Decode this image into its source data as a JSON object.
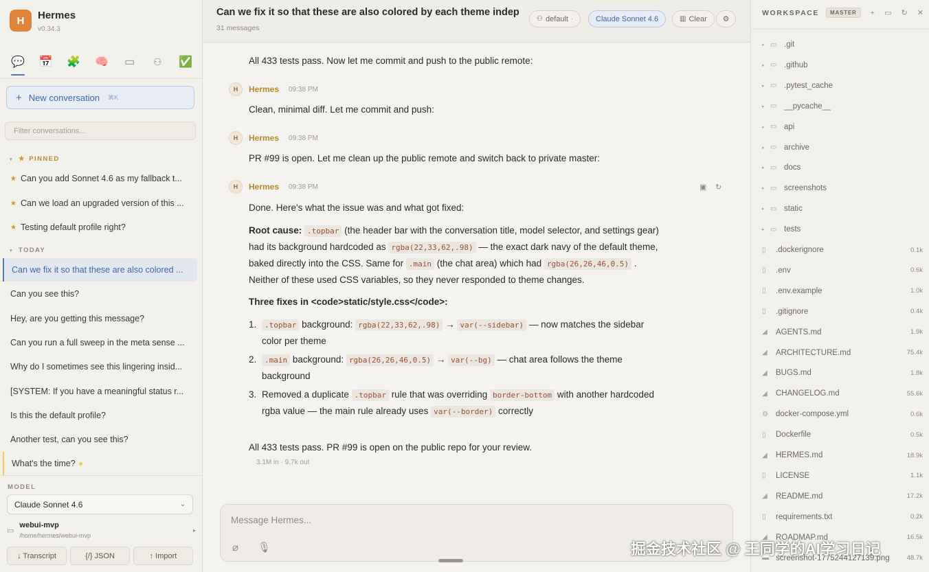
{
  "app": {
    "name": "Hermes",
    "version": "v0.34.3",
    "logo_letter": "H",
    "accent": "#e0843c"
  },
  "toolbar_icons": [
    "chat-icon",
    "calendar-icon",
    "puzzle-icon",
    "brain-icon",
    "folder-icon",
    "person-icon",
    "check-icon"
  ],
  "sidebar": {
    "new_conversation": "New conversation",
    "new_conversation_shortcut": "⌘K",
    "filter_placeholder": "Filter conversations...",
    "pinned_label": "PINNED",
    "today_label": "TODAY",
    "pinned": [
      "Can you add Sonnet 4.6 as my fallback t...",
      "Can we load an upgraded version of this ...",
      "Testing default profile right?"
    ],
    "today": [
      "Can we fix it so that these are also colored ...",
      "Can you see this?",
      "Hey, are you getting this message?",
      "Can you run a full sweep in the meta sense ...",
      "Why do I sometimes see this lingering insid...",
      "[SYSTEM: If you have a meaningful status r...",
      "Is this the default profile?",
      "Another test, can you see this?",
      "What's the time?"
    ],
    "model_label": "MODEL",
    "model_value": "Claude Sonnet 4.6",
    "workspace_name": "webui-mvp",
    "workspace_path": "/home/hermes/webui-mvp",
    "buttons": {
      "transcript": "↓ Transcript",
      "json": "{/} JSON",
      "import": "↑ Import"
    }
  },
  "topbar": {
    "title": "Can we fix it so that these are also colored by each theme indep",
    "count": "31 messages",
    "profile": "default",
    "model": "Claude Sonnet 4.6",
    "clear": "Clear"
  },
  "messages": {
    "m0": "All 433 tests pass. Now let me commit and push to the public remote:",
    "author": "Hermes",
    "avatar": "H",
    "time": "09:38 PM",
    "m1": "Clean, minimal diff. Let me commit and push:",
    "m2": "PR #99 is open. Let me clean up the public remote and switch back to private master:",
    "m3_intro": "Done. Here's what the issue was and what got fixed:",
    "root": {
      "label": "Root cause:",
      "c1": ".topbar",
      "t1": " (the header bar with the conversation title, model selector, and settings gear)",
      "t2": "had its background hardcoded as ",
      "c2": "rgba(22,33,62,.98)",
      "t3": " — the exact dark navy of the default theme,",
      "t4": "baked directly into the CSS. Same for ",
      "c3": ".main",
      "t5": " (the chat area) which had ",
      "c4": "rgba(26,26,46,0.5)",
      "t6": " .",
      "t7": "Neither of these used CSS variables, so they never responded to theme changes."
    },
    "fixes_heading": "Three fixes in <code>static/style.css</code>:",
    "fix1": {
      "num": "1.",
      "c1": ".topbar",
      "t1": " background: ",
      "c2": "rgba(22,33,62,.98)",
      "arrow": " → ",
      "c3": "var(--sidebar)",
      "t2": " — now matches the sidebar",
      "t3": "color per theme"
    },
    "fix2": {
      "num": "2.",
      "c1": ".main",
      "t1": " background: ",
      "c2": "rgba(26,26,46,0.5)",
      "arrow": " → ",
      "c3": "var(--bg)",
      "t2": " — chat area follows the theme",
      "t3": "background"
    },
    "fix3": {
      "num": "3.",
      "t1": "Removed a duplicate ",
      "c1": ".topbar",
      "t2": " rule that was overriding ",
      "c2": "border-bottom",
      "t3": " with another hardcoded",
      "t4": "rgba value — the main rule already uses ",
      "c3": "var(--border)",
      "t5": " correctly"
    },
    "final": "All 433 tests pass. PR #99 is open on the public repo for your review.",
    "stats": "3.1M in · 9.7k out"
  },
  "composer": {
    "placeholder": "Message Hermes..."
  },
  "workspace": {
    "title": "WORKSPACE",
    "branch": "MASTER",
    "folders": [
      ".git",
      ".github",
      ".pytest_cache",
      "__pycache__",
      "api",
      "archive",
      "docs",
      "screenshots",
      "static",
      "tests"
    ],
    "files": [
      {
        "name": ".dockerignore",
        "size": "0.1k",
        "icon": "file-icon"
      },
      {
        "name": ".env",
        "size": "0.6k",
        "icon": "file-icon"
      },
      {
        "name": ".env.example",
        "size": "1.0k",
        "icon": "file-icon"
      },
      {
        "name": ".gitignore",
        "size": "0.4k",
        "icon": "file-icon"
      },
      {
        "name": "AGENTS.md",
        "size": "1.9k",
        "icon": "markdown-icon"
      },
      {
        "name": "ARCHITECTURE.md",
        "size": "75.4k",
        "icon": "markdown-icon"
      },
      {
        "name": "BUGS.md",
        "size": "1.8k",
        "icon": "markdown-icon"
      },
      {
        "name": "CHANGELOG.md",
        "size": "55.6k",
        "icon": "markdown-icon"
      },
      {
        "name": "docker-compose.yml",
        "size": "0.6k",
        "icon": "gear-icon"
      },
      {
        "name": "Dockerfile",
        "size": "0.5k",
        "icon": "file-icon"
      },
      {
        "name": "HERMES.md",
        "size": "18.9k",
        "icon": "markdown-icon"
      },
      {
        "name": "LICENSE",
        "size": "1.1k",
        "icon": "file-icon"
      },
      {
        "name": "README.md",
        "size": "17.2k",
        "icon": "markdown-icon"
      },
      {
        "name": "requirements.txt",
        "size": "0.2k",
        "icon": "file-icon"
      },
      {
        "name": "ROADMAP.md",
        "size": "16.5k",
        "icon": "markdown-icon"
      },
      {
        "name": "screenshot-1775244127139.png",
        "size": "48.7k",
        "icon": "image-icon"
      }
    ]
  },
  "watermark": "掘金技术社区 @ 王同学的AI学习日记"
}
